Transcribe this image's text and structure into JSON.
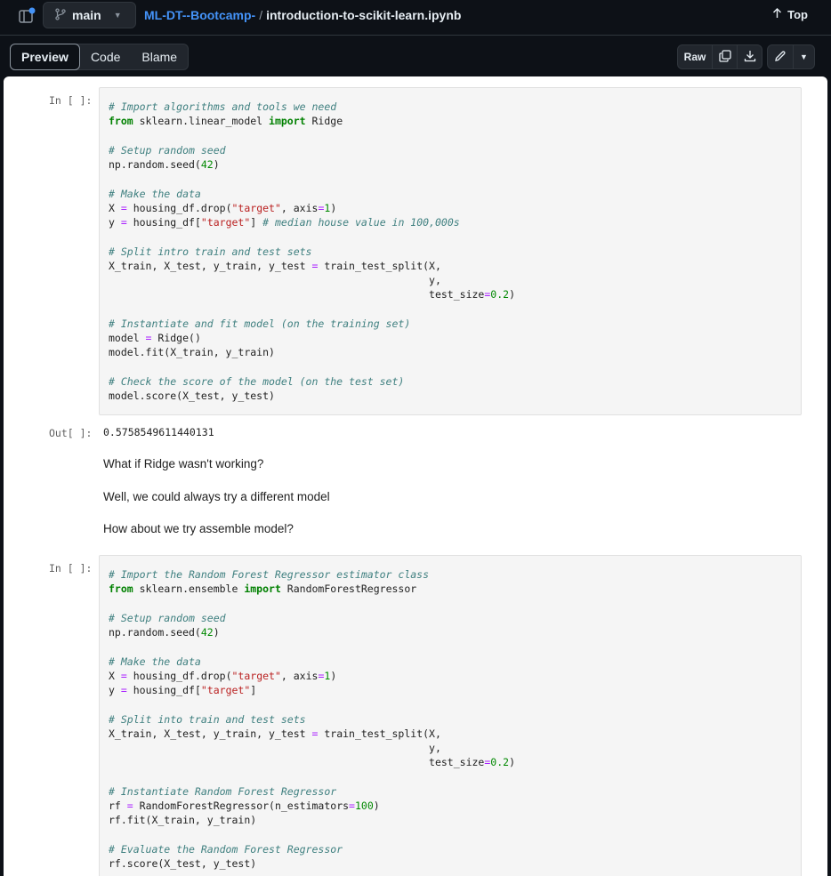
{
  "header": {
    "branch": "main",
    "repo": "ML-DT--Bootcamp-",
    "separator": "/",
    "file": "introduction-to-scikit-learn.ipynb",
    "top_label": "Top"
  },
  "toolbar": {
    "tabs": [
      {
        "label": "Preview",
        "active": true
      },
      {
        "label": "Code",
        "active": false
      },
      {
        "label": "Blame",
        "active": false
      }
    ],
    "raw_label": "Raw",
    "icons": [
      "copy-icon",
      "download-icon",
      "pencil-icon",
      "chevron-down-icon"
    ]
  },
  "cells": [
    {
      "prompt": "In [ ]:"
    },
    {
      "prompt": "Out[ ]:",
      "output": "0.5758549611440131"
    },
    {
      "markdown": [
        "What if Ridge wasn't working?",
        "Well, we could always try a different model",
        "How about we try assemble model?"
      ]
    },
    {
      "prompt": "In [ ]:"
    }
  ],
  "code_cells": [
    [
      [
        [
          "c",
          "# Import algorithms and tools we need"
        ]
      ],
      [
        [
          "k",
          "from"
        ],
        [
          "t",
          " sklearn.linear_model "
        ],
        [
          "k",
          "import"
        ],
        [
          "t",
          " Ridge"
        ]
      ],
      [],
      [
        [
          "c",
          "# Setup random seed"
        ]
      ],
      [
        [
          "t",
          "np.random.seed("
        ],
        [
          "n",
          "42"
        ],
        [
          "t",
          ")"
        ]
      ],
      [],
      [
        [
          "c",
          "# Make the data"
        ]
      ],
      [
        [
          "t",
          "X "
        ],
        [
          "o",
          "="
        ],
        [
          "t",
          " housing_df.drop("
        ],
        [
          "s",
          "\"target\""
        ],
        [
          "t",
          ", axis"
        ],
        [
          "o",
          "="
        ],
        [
          "n",
          "1"
        ],
        [
          "t",
          ")"
        ]
      ],
      [
        [
          "t",
          "y "
        ],
        [
          "o",
          "="
        ],
        [
          "t",
          " housing_df["
        ],
        [
          "s",
          "\"target\""
        ],
        [
          "t",
          "] "
        ],
        [
          "c",
          "# median house value in 100,000s"
        ]
      ],
      [],
      [
        [
          "c",
          "# Split intro train and test sets"
        ]
      ],
      [
        [
          "t",
          "X_train, X_test, y_train, y_test "
        ],
        [
          "o",
          "="
        ],
        [
          "t",
          " train_test_split(X,"
        ]
      ],
      [
        [
          "t",
          "                                                    y,"
        ]
      ],
      [
        [
          "t",
          "                                                    test_size"
        ],
        [
          "o",
          "="
        ],
        [
          "n",
          "0.2"
        ],
        [
          "t",
          ")"
        ]
      ],
      [],
      [
        [
          "c",
          "# Instantiate and fit model (on the training set)"
        ]
      ],
      [
        [
          "t",
          "model "
        ],
        [
          "o",
          "="
        ],
        [
          "t",
          " Ridge()"
        ]
      ],
      [
        [
          "t",
          "model.fit(X_train, y_train)"
        ]
      ],
      [],
      [
        [
          "c",
          "# Check the score of the model (on the test set)"
        ]
      ],
      [
        [
          "t",
          "model.score(X_test, y_test)"
        ]
      ]
    ],
    [
      [
        [
          "c",
          "# Import the Random Forest Regressor estimator class"
        ]
      ],
      [
        [
          "k",
          "from"
        ],
        [
          "t",
          " sklearn.ensemble "
        ],
        [
          "k",
          "import"
        ],
        [
          "t",
          " RandomForestRegressor"
        ]
      ],
      [],
      [
        [
          "c",
          "# Setup random seed"
        ]
      ],
      [
        [
          "t",
          "np.random.seed("
        ],
        [
          "n",
          "42"
        ],
        [
          "t",
          ")"
        ]
      ],
      [],
      [
        [
          "c",
          "# Make the data"
        ]
      ],
      [
        [
          "t",
          "X "
        ],
        [
          "o",
          "="
        ],
        [
          "t",
          " housing_df.drop("
        ],
        [
          "s",
          "\"target\""
        ],
        [
          "t",
          ", axis"
        ],
        [
          "o",
          "="
        ],
        [
          "n",
          "1"
        ],
        [
          "t",
          ")"
        ]
      ],
      [
        [
          "t",
          "y "
        ],
        [
          "o",
          "="
        ],
        [
          "t",
          " housing_df["
        ],
        [
          "s",
          "\"target\""
        ],
        [
          "t",
          "]"
        ]
      ],
      [],
      [
        [
          "c",
          "# Split into train and test sets"
        ]
      ],
      [
        [
          "t",
          "X_train, X_test, y_train, y_test "
        ],
        [
          "o",
          "="
        ],
        [
          "t",
          " train_test_split(X,"
        ]
      ],
      [
        [
          "t",
          "                                                    y,"
        ]
      ],
      [
        [
          "t",
          "                                                    test_size"
        ],
        [
          "o",
          "="
        ],
        [
          "n",
          "0.2"
        ],
        [
          "t",
          ")"
        ]
      ],
      [],
      [
        [
          "c",
          "# Instantiate Random Forest Regressor"
        ]
      ],
      [
        [
          "t",
          "rf "
        ],
        [
          "o",
          "="
        ],
        [
          "t",
          " RandomForestRegressor(n_estimators"
        ],
        [
          "o",
          "="
        ],
        [
          "n",
          "100"
        ],
        [
          "t",
          ")"
        ]
      ],
      [
        [
          "t",
          "rf.fit(X_train, y_train)"
        ]
      ],
      [],
      [
        [
          "c",
          "# Evaluate the Random Forest Regressor"
        ]
      ],
      [
        [
          "t",
          "rf.score(X_test, y_test)"
        ]
      ]
    ]
  ]
}
